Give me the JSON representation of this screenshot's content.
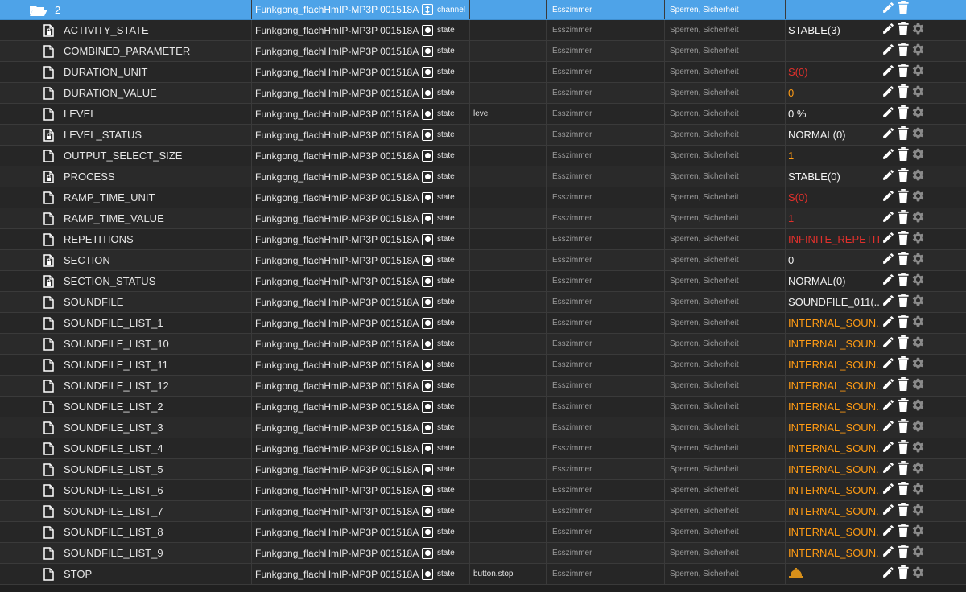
{
  "header": {
    "name": "2",
    "device": "Funkgong_flachHmIP-MP3P 001518A9...",
    "type": "channel",
    "role": "",
    "room": "Esszimmer",
    "function": "Sperren, Sicherheit",
    "value": ""
  },
  "rows": [
    {
      "name": "ACTIVITY_STATE",
      "icon": "locked-file",
      "device": "Funkgong_flachHmIP-MP3P 001518A9...",
      "type": "state",
      "role": "",
      "room": "Esszimmer",
      "function": "Sperren, Sicherheit",
      "value": "STABLE(3)",
      "value_color": "white"
    },
    {
      "name": "COMBINED_PARAMETER",
      "icon": "file",
      "device": "Funkgong_flachHmIP-MP3P 001518A9...",
      "type": "state",
      "role": "",
      "room": "Esszimmer",
      "function": "Sperren, Sicherheit",
      "value": "",
      "value_color": "white"
    },
    {
      "name": "DURATION_UNIT",
      "icon": "file",
      "device": "Funkgong_flachHmIP-MP3P 001518A9...",
      "type": "state",
      "role": "",
      "room": "Esszimmer",
      "function": "Sperren, Sicherheit",
      "value": "S(0)",
      "value_color": "red"
    },
    {
      "name": "DURATION_VALUE",
      "icon": "file",
      "device": "Funkgong_flachHmIP-MP3P 001518A9...",
      "type": "state",
      "role": "",
      "room": "Esszimmer",
      "function": "Sperren, Sicherheit",
      "value": "0",
      "value_color": "orange"
    },
    {
      "name": "LEVEL",
      "icon": "file",
      "device": "Funkgong_flachHmIP-MP3P 001518A9...",
      "type": "state",
      "role": "level",
      "room": "Esszimmer",
      "function": "Sperren, Sicherheit",
      "value": "0 %",
      "value_color": "white"
    },
    {
      "name": "LEVEL_STATUS",
      "icon": "locked-file",
      "device": "Funkgong_flachHmIP-MP3P 001518A9...",
      "type": "state",
      "role": "",
      "room": "Esszimmer",
      "function": "Sperren, Sicherheit",
      "value": "NORMAL(0)",
      "value_color": "white"
    },
    {
      "name": "OUTPUT_SELECT_SIZE",
      "icon": "file",
      "device": "Funkgong_flachHmIP-MP3P 001518A9...",
      "type": "state",
      "role": "",
      "room": "Esszimmer",
      "function": "Sperren, Sicherheit",
      "value": "1",
      "value_color": "orange"
    },
    {
      "name": "PROCESS",
      "icon": "locked-file",
      "device": "Funkgong_flachHmIP-MP3P 001518A9...",
      "type": "state",
      "role": "",
      "room": "Esszimmer",
      "function": "Sperren, Sicherheit",
      "value": "STABLE(0)",
      "value_color": "white"
    },
    {
      "name": "RAMP_TIME_UNIT",
      "icon": "file",
      "device": "Funkgong_flachHmIP-MP3P 001518A9...",
      "type": "state",
      "role": "",
      "room": "Esszimmer",
      "function": "Sperren, Sicherheit",
      "value": "S(0)",
      "value_color": "red"
    },
    {
      "name": "RAMP_TIME_VALUE",
      "icon": "file",
      "device": "Funkgong_flachHmIP-MP3P 001518A9...",
      "type": "state",
      "role": "",
      "room": "Esszimmer",
      "function": "Sperren, Sicherheit",
      "value": "1",
      "value_color": "red"
    },
    {
      "name": "REPETITIONS",
      "icon": "file",
      "device": "Funkgong_flachHmIP-MP3P 001518A9...",
      "type": "state",
      "role": "",
      "room": "Esszimmer",
      "function": "Sperren, Sicherheit",
      "value": "INFINITE_REPETIT...",
      "value_color": "red"
    },
    {
      "name": "SECTION",
      "icon": "locked-file",
      "device": "Funkgong_flachHmIP-MP3P 001518A9...",
      "type": "state",
      "role": "",
      "room": "Esszimmer",
      "function": "Sperren, Sicherheit",
      "value": "0",
      "value_color": "white"
    },
    {
      "name": "SECTION_STATUS",
      "icon": "locked-file",
      "device": "Funkgong_flachHmIP-MP3P 001518A9...",
      "type": "state",
      "role": "",
      "room": "Esszimmer",
      "function": "Sperren, Sicherheit",
      "value": "NORMAL(0)",
      "value_color": "white"
    },
    {
      "name": "SOUNDFILE",
      "icon": "file",
      "device": "Funkgong_flachHmIP-MP3P 001518A9...",
      "type": "state",
      "role": "",
      "room": "Esszimmer",
      "function": "Sperren, Sicherheit",
      "value": "SOUNDFILE_011(...",
      "value_color": "white"
    },
    {
      "name": "SOUNDFILE_LIST_1",
      "icon": "file",
      "device": "Funkgong_flachHmIP-MP3P 001518A9...",
      "type": "state",
      "role": "",
      "room": "Esszimmer",
      "function": "Sperren, Sicherheit",
      "value": "INTERNAL_SOUN...",
      "value_color": "orange"
    },
    {
      "name": "SOUNDFILE_LIST_10",
      "icon": "file",
      "device": "Funkgong_flachHmIP-MP3P 001518A9...",
      "type": "state",
      "role": "",
      "room": "Esszimmer",
      "function": "Sperren, Sicherheit",
      "value": "INTERNAL_SOUN...",
      "value_color": "orange"
    },
    {
      "name": "SOUNDFILE_LIST_11",
      "icon": "file",
      "device": "Funkgong_flachHmIP-MP3P 001518A9...",
      "type": "state",
      "role": "",
      "room": "Esszimmer",
      "function": "Sperren, Sicherheit",
      "value": "INTERNAL_SOUN...",
      "value_color": "orange"
    },
    {
      "name": "SOUNDFILE_LIST_12",
      "icon": "file",
      "device": "Funkgong_flachHmIP-MP3P 001518A9...",
      "type": "state",
      "role": "",
      "room": "Esszimmer",
      "function": "Sperren, Sicherheit",
      "value": "INTERNAL_SOUN...",
      "value_color": "orange"
    },
    {
      "name": "SOUNDFILE_LIST_2",
      "icon": "file",
      "device": "Funkgong_flachHmIP-MP3P 001518A9...",
      "type": "state",
      "role": "",
      "room": "Esszimmer",
      "function": "Sperren, Sicherheit",
      "value": "INTERNAL_SOUN...",
      "value_color": "orange"
    },
    {
      "name": "SOUNDFILE_LIST_3",
      "icon": "file",
      "device": "Funkgong_flachHmIP-MP3P 001518A9...",
      "type": "state",
      "role": "",
      "room": "Esszimmer",
      "function": "Sperren, Sicherheit",
      "value": "INTERNAL_SOUN...",
      "value_color": "orange"
    },
    {
      "name": "SOUNDFILE_LIST_4",
      "icon": "file",
      "device": "Funkgong_flachHmIP-MP3P 001518A9...",
      "type": "state",
      "role": "",
      "room": "Esszimmer",
      "function": "Sperren, Sicherheit",
      "value": "INTERNAL_SOUN...",
      "value_color": "orange"
    },
    {
      "name": "SOUNDFILE_LIST_5",
      "icon": "file",
      "device": "Funkgong_flachHmIP-MP3P 001518A9...",
      "type": "state",
      "role": "",
      "room": "Esszimmer",
      "function": "Sperren, Sicherheit",
      "value": "INTERNAL_SOUN...",
      "value_color": "orange"
    },
    {
      "name": "SOUNDFILE_LIST_6",
      "icon": "file",
      "device": "Funkgong_flachHmIP-MP3P 001518A9...",
      "type": "state",
      "role": "",
      "room": "Esszimmer",
      "function": "Sperren, Sicherheit",
      "value": "INTERNAL_SOUN...",
      "value_color": "orange"
    },
    {
      "name": "SOUNDFILE_LIST_7",
      "icon": "file",
      "device": "Funkgong_flachHmIP-MP3P 001518A9...",
      "type": "state",
      "role": "",
      "room": "Esszimmer",
      "function": "Sperren, Sicherheit",
      "value": "INTERNAL_SOUN...",
      "value_color": "orange"
    },
    {
      "name": "SOUNDFILE_LIST_8",
      "icon": "file",
      "device": "Funkgong_flachHmIP-MP3P 001518A9...",
      "type": "state",
      "role": "",
      "room": "Esszimmer",
      "function": "Sperren, Sicherheit",
      "value": "INTERNAL_SOUN...",
      "value_color": "orange"
    },
    {
      "name": "SOUNDFILE_LIST_9",
      "icon": "file",
      "device": "Funkgong_flachHmIP-MP3P 001518A9...",
      "type": "state",
      "role": "",
      "room": "Esszimmer",
      "function": "Sperren, Sicherheit",
      "value": "INTERNAL_SOUN...",
      "value_color": "orange"
    },
    {
      "name": "STOP",
      "icon": "file",
      "device": "Funkgong_flachHmIP-MP3P 001518A9...",
      "type": "state",
      "role": "button.stop",
      "room": "Esszimmer",
      "function": "Sperren, Sicherheit",
      "value": "",
      "value_icon": "bell-icon",
      "value_color": "white"
    }
  ],
  "colors": {
    "header_bg": "#4ea3e8",
    "value_orange": "#ff9b14",
    "value_red": "#e0302c",
    "value_white": "#f2f2f2"
  }
}
